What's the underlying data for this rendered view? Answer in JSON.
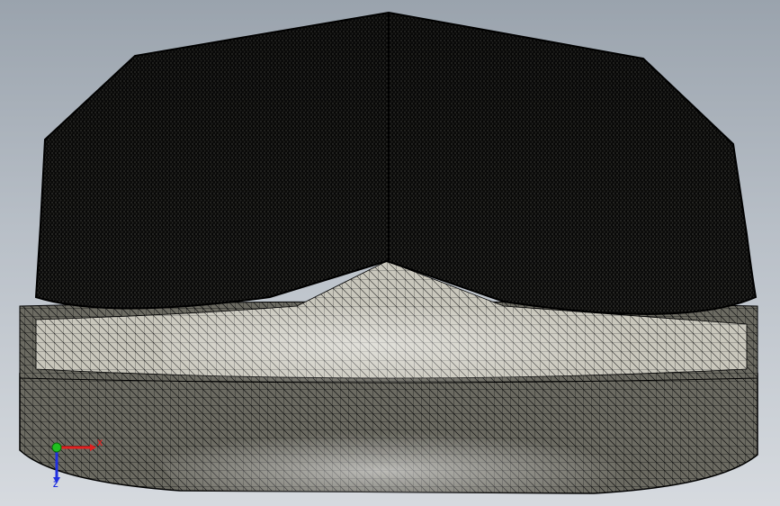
{
  "viewport": {
    "background_top": "#9aa3ad",
    "background_bottom": "#d6dadf"
  },
  "model": {
    "render_mode": "mesh-wireframe",
    "edge_color": "#000000",
    "face_dark": "#3a3a36",
    "face_light": "#d8d6cc"
  },
  "triad": {
    "x_label": "X",
    "z_label": "Z",
    "x_color": "#e02020",
    "y_color": "#20c020",
    "z_color": "#2030e0"
  }
}
